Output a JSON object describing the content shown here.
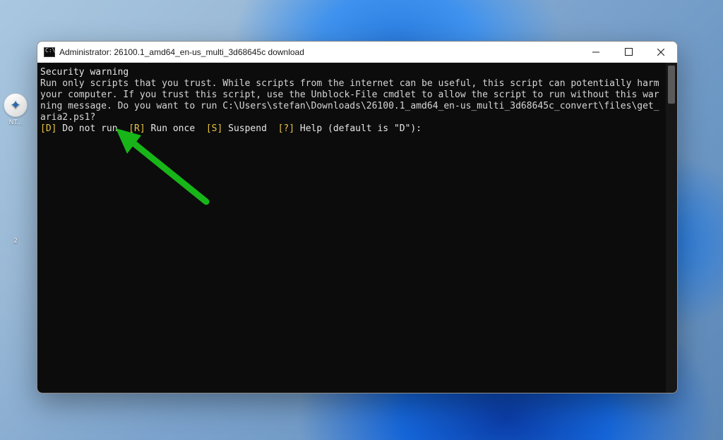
{
  "desktop": {
    "icon_label": "NT...",
    "time_label": "2"
  },
  "window": {
    "title": "Administrator:  26100.1_amd64_en-us_multi_3d68645c download"
  },
  "terminal": {
    "heading": "Security warning",
    "body_text": "Run only scripts that you trust. While scripts from the internet can be useful, this script can potentially harm your computer. If you trust this script, use the Unblock-File cmdlet to allow the script to run without this warning message. Do you want to run C:\\Users\\stefan\\Downloads\\26100.1_amd64_en-us_multi_3d68645c_convert\\files\\get_aria2.ps1?",
    "prompt": {
      "opt_d_key": "[D]",
      "opt_d_label": " Do not run  ",
      "opt_r_key": "[R]",
      "opt_r_label": " Run once  ",
      "opt_s_key": "[S]",
      "opt_s_label": " Suspend  ",
      "opt_help_key": "[?]",
      "opt_help_label": " Help (default is \"D\"):"
    }
  },
  "annotation": {
    "arrow_color": "#18b519"
  }
}
